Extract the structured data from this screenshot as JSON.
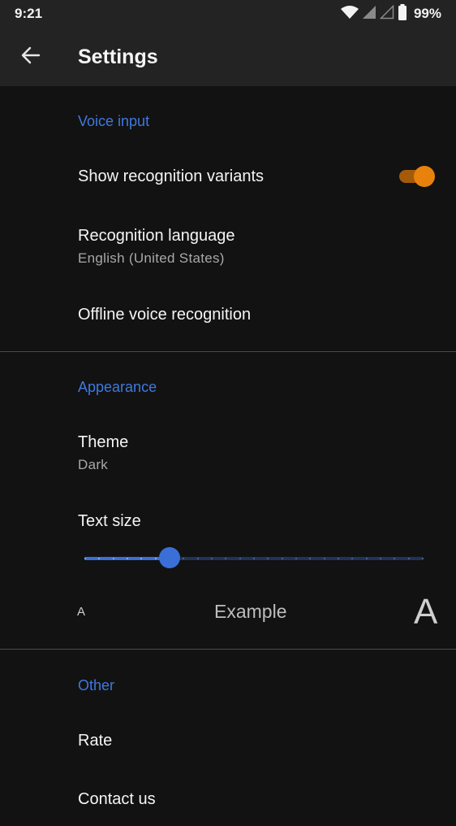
{
  "status_bar": {
    "time": "9:21",
    "battery": "99%",
    "icons": [
      "wifi-icon",
      "signal-icon",
      "signal-empty-icon",
      "battery-icon"
    ]
  },
  "app_bar": {
    "back_icon": "arrow-left-icon",
    "title": "Settings"
  },
  "sections": {
    "voice_input": {
      "header": "Voice input",
      "show_variants": {
        "title": "Show recognition variants",
        "enabled": true
      },
      "language": {
        "title": "Recognition language",
        "summary": "English (United States)"
      },
      "offline": {
        "title": "Offline voice recognition"
      }
    },
    "appearance": {
      "header": "Appearance",
      "theme": {
        "title": "Theme",
        "summary": "Dark"
      },
      "text_size": {
        "title": "Text size",
        "level": 0.25,
        "small_glyph": "A",
        "example": "Example",
        "large_glyph": "A"
      }
    },
    "other": {
      "header": "Other",
      "rate": {
        "title": "Rate"
      },
      "contact": {
        "title": "Contact us"
      }
    }
  },
  "colors": {
    "accent_blue": "#3f78e0",
    "switch_orange": "#e8820c",
    "background": "#121212",
    "appbar": "#232323"
  }
}
